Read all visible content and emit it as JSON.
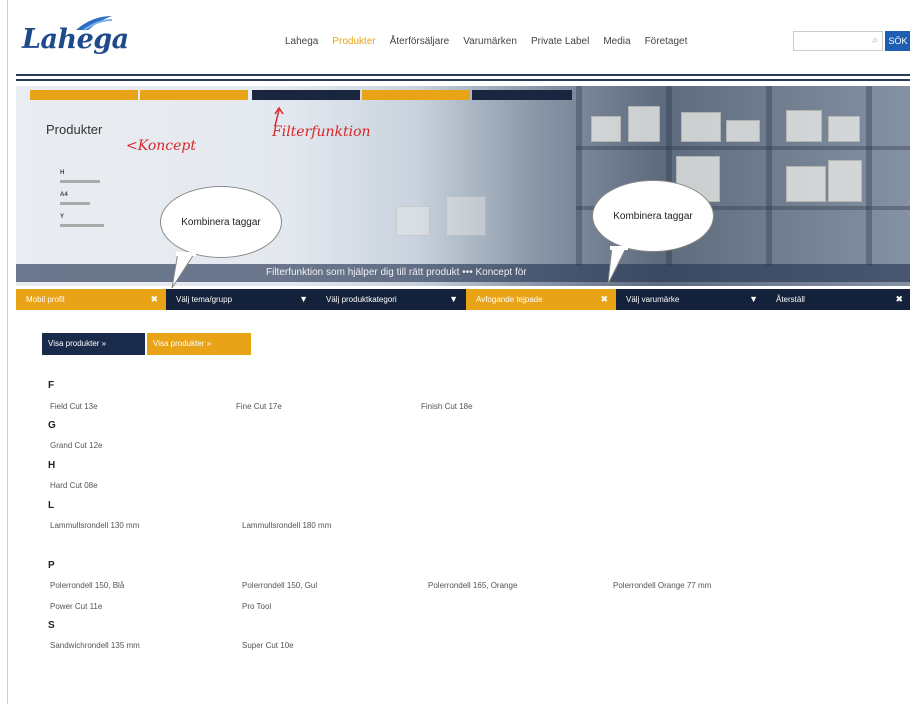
{
  "header": {
    "logo": "Lahega",
    "nav": [
      "Lahega",
      "Produkter",
      "Återförsäljare",
      "Varumärken",
      "Private Label",
      "Media",
      "Företaget"
    ],
    "active_nav": "Produkter",
    "search_button": "SÖK"
  },
  "hero": {
    "products_title": "Produkter",
    "annotation_concept": "<Koncept",
    "annotation_filter": "Filterfunktion",
    "caption": "Filterfunktion som hjälper dig till rätt produkt ••• Koncept för",
    "bubble_left": "Kombinera taggar",
    "bubble_right": "Kombinera taggar",
    "mini_letters": [
      "H",
      "A4",
      "Y"
    ]
  },
  "filters": [
    {
      "label": "Mobil profil",
      "style": "orange",
      "control": "✖"
    },
    {
      "label": "Välj tema/grupp",
      "style": "dark",
      "control": "▼"
    },
    {
      "label": "Välj produktkategori",
      "style": "dark",
      "control": "▼"
    },
    {
      "label": "Avfogande tejpade",
      "style": "orange",
      "control": "✖"
    },
    {
      "label": "Välj varumärke",
      "style": "dark",
      "control": "▼"
    },
    {
      "label": "Återställ",
      "style": "dark",
      "control": "✖"
    }
  ],
  "buttons": {
    "view_images": "Visa produkter »",
    "view_products": "Visa produkter »"
  },
  "groups": [
    {
      "letter": "F",
      "items": [
        "Field Cut 13e",
        "Fine Cut 17e",
        "Finish Cut 18e"
      ]
    },
    {
      "letter": "G",
      "items": [
        "Grand Cut 12e"
      ]
    },
    {
      "letter": "H",
      "items": [
        "Hard Cut 08e"
      ]
    },
    {
      "letter": "L",
      "items": [
        "Lammullsrondell 130 mm",
        "Lammullsrondell 180 mm"
      ]
    },
    {
      "letter": "P",
      "items": [
        "Polerrondell 150, Blå",
        "Polerrondell 150, Gul",
        "Polerrondell 165, Orange",
        "Polerrondell Orange 77 mm",
        "Power Cut 11e",
        "Pro Tool"
      ]
    },
    {
      "letter": "S",
      "items": [
        "Sandwichrondell 135 mm",
        "Super Cut 10e"
      ]
    }
  ]
}
